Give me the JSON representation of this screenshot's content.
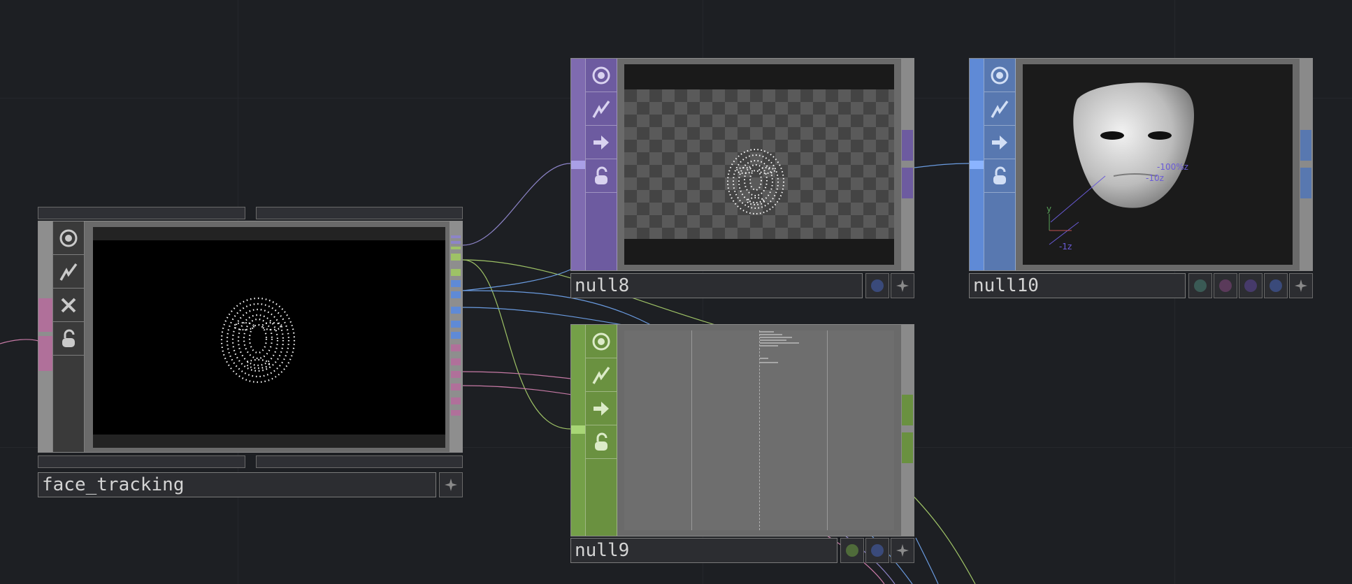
{
  "operators": {
    "face_tracking": {
      "name": "face_tracking"
    },
    "null8": {
      "name": "null8"
    },
    "null9": {
      "name": "null9"
    },
    "null10": {
      "name": "null10"
    }
  },
  "labels": {
    "null10_axis_y": "y",
    "null10_axis_z": "-1z",
    "null10_mesh_a": "-100%z",
    "null10_mesh_b": "-10z"
  },
  "colors": {
    "top_family": "#7f6bb0",
    "chop_family": "#74a048",
    "sop_family": "#5f8ad6",
    "face_tracking_strip": "#8e8e8e",
    "background": "#1d1f23"
  },
  "icons": {
    "viewer_flag": "viewer-icon",
    "bypass_flag": "bypass-icon",
    "display_flag": "display-icon",
    "lock_flag": "lock-icon",
    "cross_flag": "close-icon",
    "pin": "pin-icon"
  }
}
